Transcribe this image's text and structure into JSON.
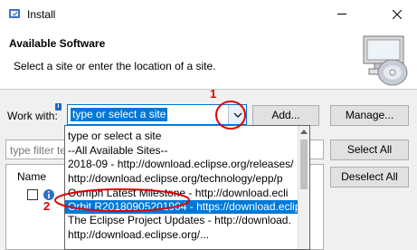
{
  "window": {
    "title": "Install",
    "minimize_label": "minimize",
    "close_label": "close"
  },
  "banner": {
    "title": "Available Software",
    "description": "Select a site or enter the location of a site."
  },
  "work_with": {
    "label": "Work with:",
    "info_badge": "i",
    "value": "type or select a site"
  },
  "buttons": {
    "add": "Add...",
    "manage": "Manage...",
    "select_all": "Select All",
    "deselect_all": "Deselect All"
  },
  "filter": {
    "placeholder": "type filter te"
  },
  "table": {
    "column_name": "Name"
  },
  "dropdown": {
    "items": [
      {
        "label": "type or select a site",
        "selected": false
      },
      {
        "label": "--All Available Sites--",
        "selected": false
      },
      {
        "label": "2018-09 - http://download.eclipse.org/releases/",
        "selected": false
      },
      {
        "label": "http://download.eclipse.org/technology/epp/p",
        "selected": false
      },
      {
        "label": "Oomph Latest Milestone - http://download.ecli",
        "selected": false
      },
      {
        "label": "Orbit R20180905201904 - https://download.eclip",
        "selected": true
      },
      {
        "label": "The Eclipse Project Updates - http://download.",
        "selected": false
      },
      {
        "label": "http://download.eclipse.org/...",
        "selected": false
      }
    ]
  },
  "annotations": {
    "step1": "1",
    "step2": "2",
    "color": "#e00000"
  },
  "colors": {
    "accent": "#0078d7",
    "window_bg": "#f0f0f0"
  }
}
